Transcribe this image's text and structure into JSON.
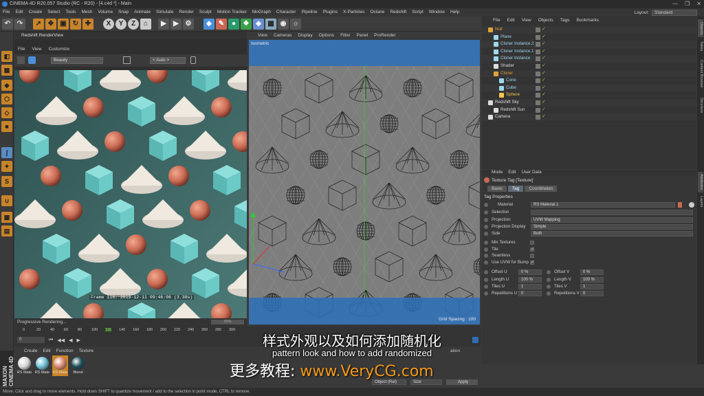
{
  "window": {
    "title": "CINEMA 4D R20.057 Studio (RC - R20) - [4.c4d *] - Main",
    "controls": [
      "—",
      "❐",
      "✕"
    ]
  },
  "menubar": [
    "File",
    "Edit",
    "Create",
    "Select",
    "Tools",
    "Mesh",
    "Volume",
    "Snap",
    "Animate",
    "Simulate",
    "Render",
    "Sculpt",
    "Motion Tracker",
    "MoGraph",
    "Character",
    "Pipeline",
    "Plugins",
    "X-Particles",
    "Octane",
    "Redshift",
    "Script",
    "Window",
    "Help"
  ],
  "layout": {
    "label": "Layout:",
    "value": "Standard"
  },
  "toolbar": {
    "x": "X",
    "y": "Y",
    "z": "Z"
  },
  "renderview": {
    "title": "Redshift RenderView",
    "menu": [
      "File",
      "View",
      "Customize"
    ],
    "aov": "Beauty",
    "zoom": "< Auto >",
    "frame_info": "Frame 116: 2019-12-11 09:46:06 (3.38s)",
    "status": "Progressive Rendering...",
    "progress": "33%"
  },
  "viewport": {
    "menu": [
      "View",
      "Cameras",
      "Display",
      "Options",
      "Filter",
      "Panel",
      "ProRender"
    ],
    "label": "Isometric",
    "grid_spacing": "Grid Spacing : 100"
  },
  "object_manager": {
    "menu": [
      "File",
      "Edit",
      "View",
      "Objects",
      "Tags",
      "Bookmarks"
    ],
    "rows": [
      {
        "name": "Null",
        "indent": 0,
        "color": "#e0a33c",
        "icon": "null-icon"
      },
      {
        "name": "Plane",
        "indent": 1,
        "color": "#9ed7ee",
        "icon": "plane-icon"
      },
      {
        "name": "Cloner Instance.2",
        "indent": 1,
        "color": "#9ed7ee",
        "icon": "cloner-instance-icon"
      },
      {
        "name": "Cloner Instance.1",
        "indent": 1,
        "color": "#9ed7ee",
        "icon": "cloner-instance-icon"
      },
      {
        "name": "Cloner Instance",
        "indent": 1,
        "color": "#9ed7ee",
        "icon": "cloner-instance-icon"
      },
      {
        "name": "Shader",
        "indent": 1,
        "color": "#dddddd",
        "icon": "shader-icon"
      },
      {
        "name": "Cloner",
        "indent": 1,
        "color": "#e0a33c",
        "icon": "cloner-icon"
      },
      {
        "name": "Cone",
        "indent": 2,
        "color": "#9ed7ee",
        "icon": "cone-icon"
      },
      {
        "name": "Cube",
        "indent": 2,
        "color": "#9ed7ee",
        "icon": "cube-icon"
      },
      {
        "name": "Sphere",
        "indent": 2,
        "color": "#f2c94c",
        "icon": "sphere-icon"
      },
      {
        "name": "Redshift Sky",
        "indent": 0,
        "color": "#dddddd",
        "icon": "redshift-sky-icon"
      },
      {
        "name": "Redshift Sun",
        "indent": 1,
        "color": "#dddddd",
        "icon": "redshift-sun-icon"
      },
      {
        "name": "Camera",
        "indent": 0,
        "color": "#dddddd",
        "icon": "camera-icon"
      }
    ]
  },
  "side_tabs": [
    "Objects",
    "Takes",
    "Content Browser",
    "Structure"
  ],
  "side_tabs2": [
    "Attributes",
    "Layers"
  ],
  "attributes": {
    "menu": [
      "Mode",
      "Edit",
      "User Data"
    ],
    "title": "Texture Tag [Texture]",
    "tabs": [
      "Basic",
      "Tag",
      "Coordinates"
    ],
    "section": "Tag Properties",
    "material_label": "Material",
    "material_value": "RS Material.1",
    "selection_label": "Selection",
    "projection_label": "Projection",
    "projection_value": "UVW Mapping",
    "projection_display_label": "Projection Display",
    "projection_display_value": "Simple",
    "side_label": "Side",
    "side_value": "Both",
    "mix_label": "Mix Textures",
    "tile_label": "Tile",
    "seamless_label": "Seamless",
    "uvw_bump_label": "Use UVW for Bump",
    "offset_u_label": "Offset U",
    "offset_u": "0 %",
    "offset_v_label": "Offset V",
    "offset_v": "0 %",
    "length_u_label": "Length U",
    "length_u": "100 %",
    "length_v_label": "Length V",
    "length_v": "100 %",
    "tiles_u_label": "Tiles U",
    "tiles_u": "1",
    "tiles_v_label": "Tiles V",
    "tiles_v": "1",
    "rep_u_label": "Repetitions U",
    "rep_u": "0",
    "rep_v_label": "Repetitions V",
    "rep_v": "0"
  },
  "timeline": {
    "ticks": [
      "0",
      "20",
      "40",
      "60",
      "80",
      "100",
      "116",
      "140",
      "160",
      "180",
      "200",
      "220",
      "240",
      "260",
      "280",
      "300"
    ],
    "current_frame": "0"
  },
  "material_manager": {
    "menu": [
      "Create",
      "Edit",
      "Function",
      "Texture"
    ],
    "materials": [
      {
        "name": "RS Mate",
        "color": "#d8d8d8"
      },
      {
        "name": "RS Mate",
        "color": "#6fc1d4"
      },
      {
        "name": "RS Mate",
        "color": "#d88a72"
      },
      {
        "name": "Blend",
        "color": "#1e4e57"
      }
    ],
    "right_label": "ation",
    "object_sel": "Object (Rel)",
    "size_sel": "Size",
    "apply": "Apply"
  },
  "brand": "MAXON CINEMA 4D",
  "statusbar": "Move: Click and drag to move elements. Hold down SHIFT to quantize movement / add to the selection in point mode, CTRL to remove.",
  "subtitle_cn": "样式外观以及如何添加随机化",
  "subtitle_en": "pattern look and how to add randomized",
  "watermark_cn": "更多教程:",
  "watermark_url": "www.VeryCG.com"
}
